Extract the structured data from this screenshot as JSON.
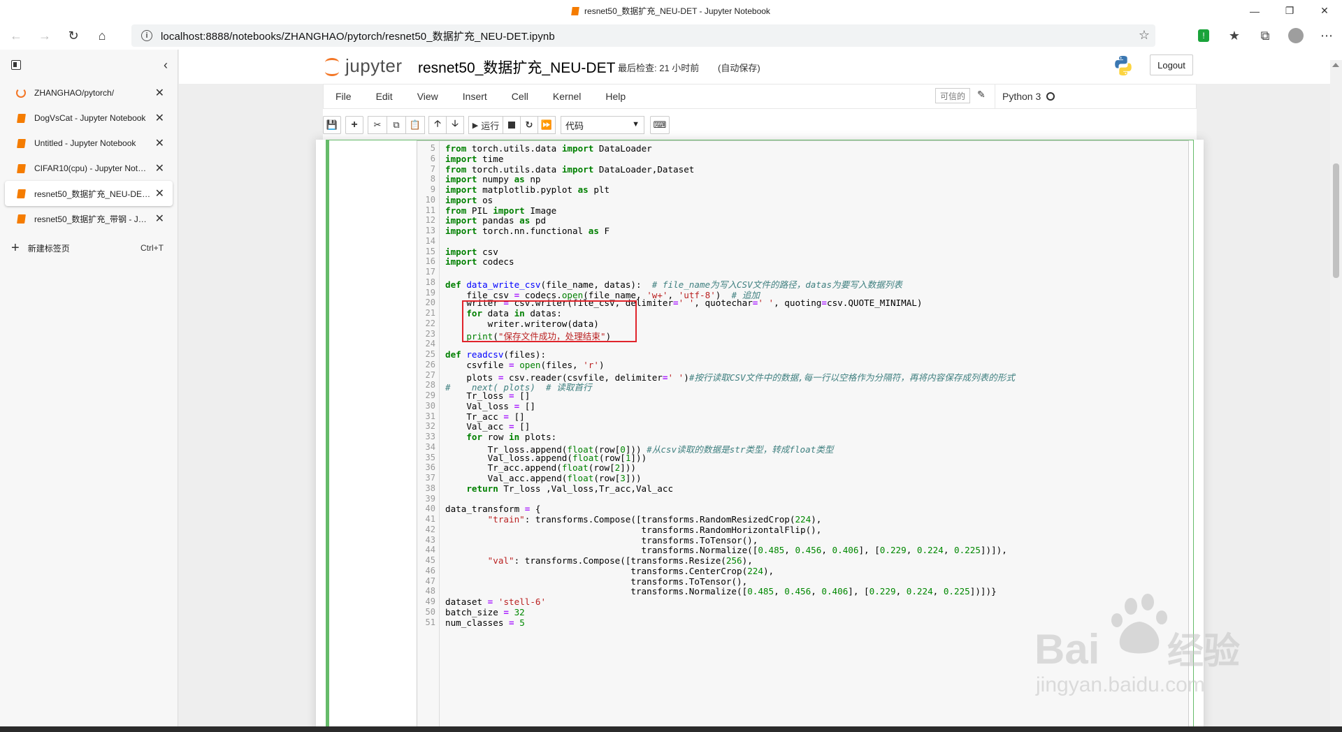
{
  "window": {
    "title": "resnet50_数据扩充_NEU-DET - Jupyter Notebook",
    "controls": [
      "minimize",
      "restore",
      "close"
    ]
  },
  "address_bar": {
    "url": "localhost:8888/notebooks/ZHANGHAO/pytorch/resnet50_数据扩充_NEU-DET.ipynb"
  },
  "sidebar": {
    "tabs": [
      {
        "label": "ZHANGHAO/pytorch/",
        "icon": "jupyter-ring-icon"
      },
      {
        "label": "DogVsCat - Jupyter Notebook",
        "icon": "notebook-icon"
      },
      {
        "label": "Untitled - Jupyter Notebook",
        "icon": "notebook-icon"
      },
      {
        "label": "CIFAR10(cpu) - Jupyter Notebook",
        "icon": "notebook-icon"
      },
      {
        "label": "resnet50_数据扩充_NEU-DET - Jupyter Notebook",
        "icon": "notebook-icon",
        "active": true
      },
      {
        "label": "resnet50_数据扩充_带钢 - Jupyter Notebook",
        "icon": "notebook-icon"
      }
    ],
    "new_tab": {
      "label": "新建标签页",
      "shortcut": "Ctrl+T"
    }
  },
  "jupyter": {
    "logo_text": "jupyter",
    "notebook_name": "resnet50_数据扩充_NEU-DET",
    "checkpoint": "最后检查: 21 小时前",
    "autosave": "(自动保存)",
    "logout": "Logout",
    "menu": [
      "File",
      "Edit",
      "View",
      "Insert",
      "Cell",
      "Kernel",
      "Help"
    ],
    "trusted": "可信的",
    "kernel_name": "Python 3",
    "toolbar": {
      "run_label": "运行",
      "cell_type": "代码"
    }
  },
  "colors": {
    "jupyter_orange": "#f37626",
    "cell_border_green": "#66bb6a",
    "annotation_red": "#e0242b",
    "highlight_green": "#4fd34f"
  },
  "code": {
    "first_line_number": 5,
    "lines": [
      "from torch.utils.data import DataLoader",
      "import time",
      "from torch.utils.data import DataLoader,Dataset",
      "import numpy as np",
      "import matplotlib.pyplot as plt",
      "import os",
      "from PIL import Image",
      "import pandas as pd",
      "import torch.nn.functional as F",
      "",
      "import csv",
      "import codecs",
      "",
      "def data_write_csv(file_name, datas):  # file_name为写入CSV文件的路径，datas为要写入数据列表",
      "    file_csv = codecs.open(file_name, 'w+', 'utf-8')  # 追加",
      "    writer = csv.writer(file_csv, delimiter=' ', quotechar=' ', quoting=csv.QUOTE_MINIMAL)",
      "    for data in datas:",
      "        writer.writerow(data)",
      "    print(\"保存文件成功，处理结束\")",
      "",
      "def readcsv(files):",
      "    csvfile = open(files, 'r')",
      "    plots = csv.reader(csvfile, delimiter=' ')#按行读取CSV文件中的数据,每一行以空格作为分隔符，再将内容保存成列表的形式",
      "#    next( plots)  # 读取首行",
      "    Tr_loss = []",
      "    Val_loss = []",
      "    Tr_acc = []",
      "    Val_acc = []",
      "    for row in plots:",
      "        Tr_loss.append(float(row[0])) #从csv读取的数据是str类型，转成float类型",
      "        Val_loss.append(float(row[1]))",
      "        Tr_acc.append(float(row[2]))",
      "        Val_acc.append(float(row[3]))",
      "    return Tr_loss ,Val_loss,Tr_acc,Val_acc",
      "",
      "data_transform = {",
      "        \"train\": transforms.Compose([transforms.RandomResizedCrop(224),",
      "                                     transforms.RandomHorizontalFlip(),",
      "                                     transforms.ToTensor(),",
      "                                     transforms.Normalize([0.485, 0.456, 0.406], [0.229, 0.224, 0.225])]),",
      "        \"val\": transforms.Compose([transforms.Resize(256),",
      "                                   transforms.CenterCrop(224),",
      "                                   transforms.ToTensor(),",
      "                                   transforms.Normalize([0.485, 0.456, 0.406], [0.229, 0.224, 0.225])])}",
      "dataset = 'stell-6'",
      "batch_size = 32",
      "num_classes = 5"
    ]
  },
  "watermark": {
    "brand": "Bai",
    "brand_cn": "经验",
    "url": "jingyan.baidu.com"
  }
}
